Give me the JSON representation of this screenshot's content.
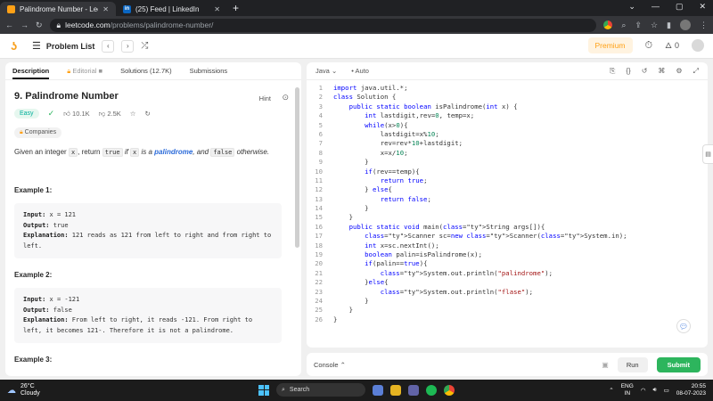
{
  "browser": {
    "tabs": [
      {
        "title": "Palindrome Number - LeetCode",
        "active": true
      },
      {
        "title": "(25) Feed | LinkedIn",
        "active": false
      }
    ],
    "url_domain": "leetcode.com",
    "url_path": "/problems/palindrome-number/"
  },
  "header": {
    "problem_list": "Problem List",
    "premium": "Premium",
    "fire_count": "0"
  },
  "left": {
    "tabs": {
      "description": "Description",
      "editorial": "Editorial",
      "solutions": "Solutions (12.7K)",
      "submissions": "Submissions"
    },
    "title": "9. Palindrome Number",
    "hint": "Hint",
    "difficulty": "Easy",
    "likes": "10.1K",
    "dislikes": "2.5K",
    "companies": "Companies",
    "desc": {
      "p1": "Given an integer ",
      "c1": "x",
      "p2": ", return ",
      "c2": "true",
      "p3": " if ",
      "c3": "x",
      "p4": " is a ",
      "pal": "palindrome",
      "p5": ", and ",
      "c4": "false",
      "p6": " otherwise."
    },
    "examples": [
      {
        "title": "Example 1:",
        "input_label": "Input:",
        "input": "x = 121",
        "output_label": "Output:",
        "output": "true",
        "expl_label": "Explanation:",
        "explanation": "121 reads as 121 from left to right and from right to left."
      },
      {
        "title": "Example 2:",
        "input_label": "Input:",
        "input": "x = -121",
        "output_label": "Output:",
        "output": "false",
        "expl_label": "Explanation:",
        "explanation": "From left to right, it reads -121. From right to left, it becomes 121-. Therefore it is not a palindrome."
      }
    ],
    "example3_title": "Example 3:"
  },
  "editor": {
    "language": "Java",
    "mode": "Auto",
    "lines": [
      "import java.util.*;",
      "class Solution {",
      "    public static boolean isPalindrome(int x) {",
      "        int lastdigit,rev=0, temp=x;",
      "        while(x>0){",
      "            lastdigit=x%10;",
      "            rev=rev*10+lastdigit;",
      "            x=x/10;",
      "        }",
      "        if(rev==temp){",
      "            return true;",
      "        } else{",
      "            return false;",
      "        }",
      "    }",
      "    public static void main(String args[]){",
      "        Scanner sc=new Scanner(System.in);",
      "        int x=sc.nextInt();",
      "        boolean palin=isPalindrome(x);",
      "        if(palin==true){",
      "            System.out.println(\"palindrome\");",
      "        }else{",
      "            System.out.println(\"flase\");",
      "        }",
      "    }",
      "}"
    ]
  },
  "console": {
    "label": "Console",
    "run": "Run",
    "submit": "Submit"
  },
  "taskbar": {
    "temp": "26°C",
    "weather": "Cloudy",
    "search": "Search",
    "lang": "ENG",
    "region": "IN",
    "time": "20:55",
    "date": "08-07-2023"
  }
}
